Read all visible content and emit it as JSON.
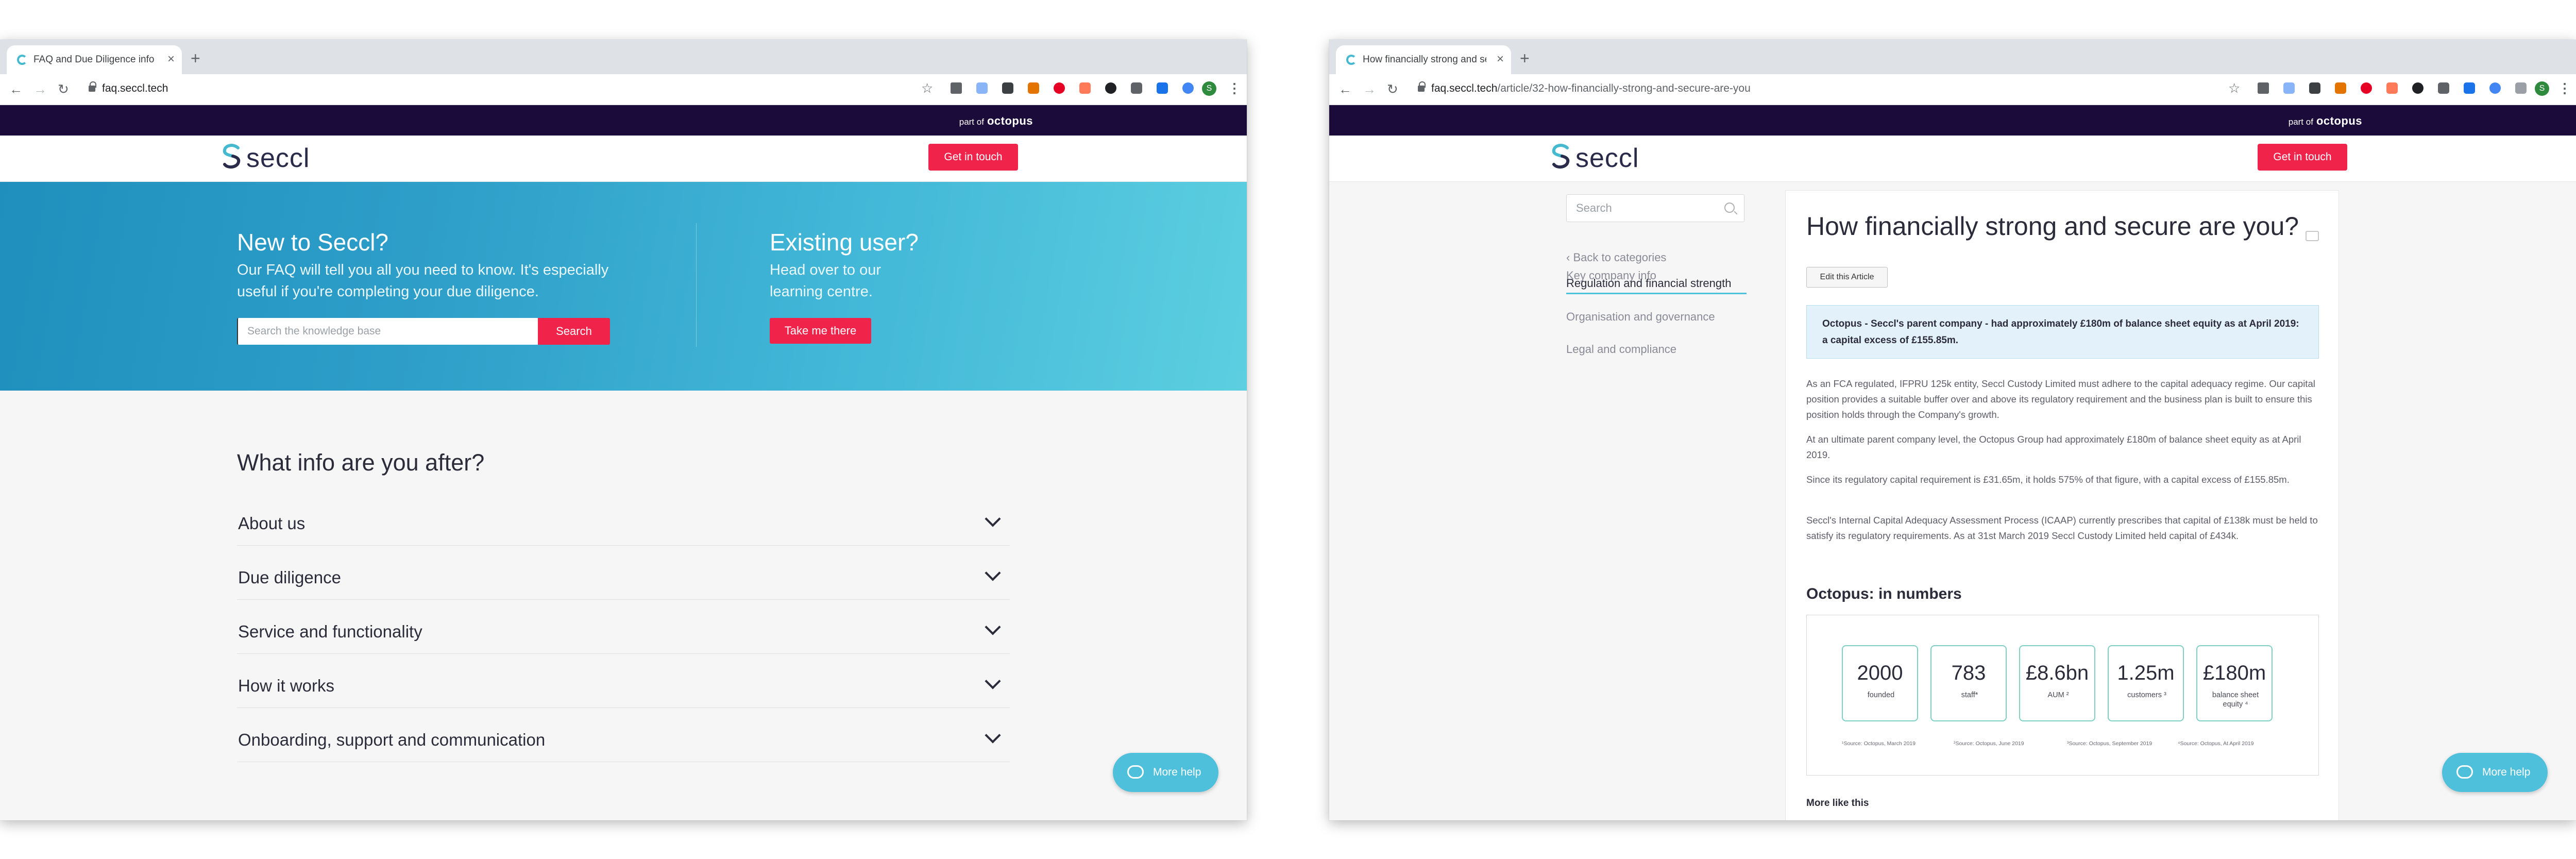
{
  "left": {
    "tab_title": "FAQ and Due Diligence info | S",
    "url": "faq.seccl.tech",
    "url_path": "",
    "banner": {
      "part_of": "part of",
      "brand": "octopus"
    },
    "logo": "seccl",
    "get_in_touch": "Get in touch",
    "hero": {
      "new_title": "New to Seccl?",
      "new_sub": "Our FAQ will tell you all you need to know. It's especially useful if you're completing your due diligence.",
      "search_placeholder": "Search the knowledge base",
      "search_button": "Search",
      "existing_title": "Existing user?",
      "existing_sub": "Head over to our learning centre.",
      "take_button": "Take me there"
    },
    "info_title": "What info are you after?",
    "accordion": [
      "About us",
      "Due diligence",
      "Service and functionality",
      "How it works",
      "Onboarding, support and communication"
    ],
    "more_help": "More help"
  },
  "right": {
    "tab_title": "How financially strong and sec",
    "url": "faq.seccl.tech",
    "url_path": "/article/32-how-financially-strong-and-secure-are-you",
    "banner": {
      "part_of": "part of",
      "brand": "octopus"
    },
    "logo": "seccl",
    "get_in_touch": "Get in touch",
    "sidebar": {
      "search_placeholder": "Search",
      "back": "‹ Back to categories",
      "items": [
        "Key company info",
        "Regulation and financial strength",
        "Organisation and governance",
        "Legal and compliance"
      ]
    },
    "article": {
      "title": "How financially strong and secure are you?",
      "edit": "Edit this Article",
      "callout": "Octopus - Seccl's parent company - had approximately £180m of balance sheet equity as at April 2019: a capital excess of £155.85m.",
      "paragraphs": [
        "As an FCA regulated, IFPRU 125k entity, Seccl Custody Limited must adhere to the capital adequacy regime. Our capital position provides a suitable buffer over and above its regulatory requirement and the business plan is built to ensure this position holds through the Company's growth.",
        "At an ultimate parent company level, the Octopus Group had approximately £180m of balance sheet equity as at April 2019.",
        "Since its regulatory capital requirement is £31.65m, it holds 575% of that figure, with a capital excess of £155.85m.",
        "Seccl's Internal Capital Adequacy Assessment Process (ICAAP) currently prescribes that capital of £138k must be held to satisfy its regulatory requirements. As at 31st March 2019 Seccl Custody Limited held capital of £434k."
      ],
      "numbers_title": "Octopus: in numbers",
      "numbers": [
        {
          "value": "2000",
          "label": "founded"
        },
        {
          "value": "783",
          "label": "staff*"
        },
        {
          "value": "£8.6bn",
          "label": "AUM ²"
        },
        {
          "value": "1.25m",
          "label": "customers ³"
        },
        {
          "value": "£180m",
          "label": "balance sheet equity ⁴"
        }
      ],
      "sources": [
        "¹Source: Octopus, March 2019",
        "²Source: Octopus, June 2019",
        "³Source: Octopus, September 2019",
        "⁴Source: Octopus, At April 2019"
      ],
      "more_like": "More like this"
    },
    "more_help": "More help"
  },
  "colors": {
    "brand_red": "#f0234b",
    "octopus_bar": "#1b0b3a",
    "accent_teal": "#4fc0dc"
  }
}
